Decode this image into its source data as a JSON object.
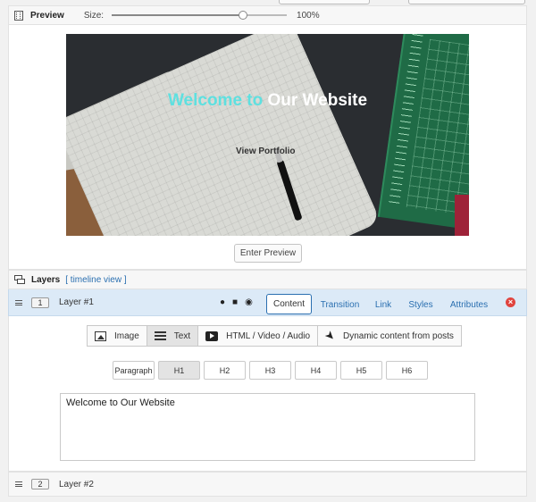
{
  "preview": {
    "title": "Preview",
    "size_label": "Size:",
    "zoom_value": "100%",
    "zoom_fraction": 0.75,
    "slide": {
      "title_highlight": "Welcome to",
      "title_rest": " Our Website",
      "button_text": "View Portfolio"
    },
    "enter_button": "Enter Preview"
  },
  "layers": {
    "title": "Layers",
    "timeline_link": "[ timeline view ]",
    "items": [
      {
        "number": "1",
        "name": "Layer #1",
        "tool_icons": [
          "bulb-icon",
          "lock-icon",
          "eye-icon"
        ],
        "tabs": [
          {
            "label": "Content",
            "active": true
          },
          {
            "label": "Transition",
            "active": false
          },
          {
            "label": "Link",
            "active": false
          },
          {
            "label": "Styles",
            "active": false
          },
          {
            "label": "Attributes",
            "active": false
          }
        ],
        "content_types": [
          {
            "label": "Image",
            "icon": "image-icon",
            "active": false
          },
          {
            "label": "Text",
            "icon": "text-icon",
            "active": true
          },
          {
            "label": "HTML / Video / Audio",
            "icon": "video-icon",
            "active": false
          },
          {
            "label": "Dynamic content from posts",
            "icon": "pin-icon",
            "active": false
          }
        ],
        "heading_options": [
          {
            "label": "Paragraph",
            "active": false
          },
          {
            "label": "H1",
            "active": true
          },
          {
            "label": "H2",
            "active": false
          },
          {
            "label": "H3",
            "active": false
          },
          {
            "label": "H4",
            "active": false
          },
          {
            "label": "H5",
            "active": false
          },
          {
            "label": "H6",
            "active": false
          }
        ],
        "text_value": "Welcome to Our Website"
      },
      {
        "number": "2",
        "name": "Layer #2"
      }
    ]
  },
  "colors": {
    "accent": "#2a6fb0",
    "highlight_text": "#5ee0e0",
    "selected_row": "#dceaf7",
    "delete": "#e0443e"
  }
}
